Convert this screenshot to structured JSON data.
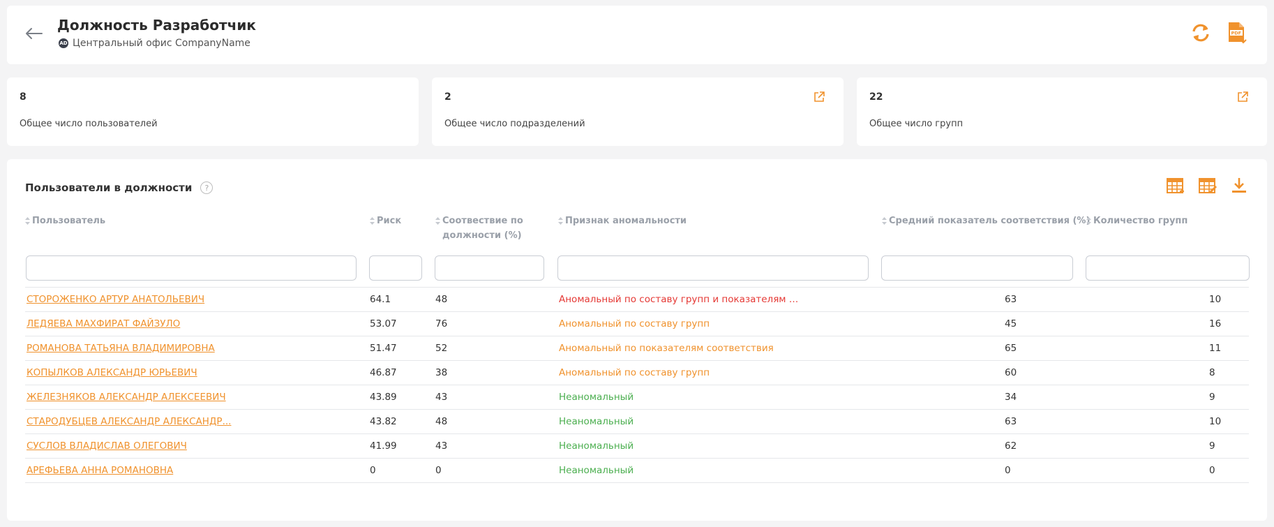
{
  "header": {
    "title": "Должность Разработчик",
    "subtitle": "Центральный офис CompanyName",
    "ad_badge": "AD"
  },
  "stats": [
    {
      "value": "8",
      "label": "Общее число пользователей"
    },
    {
      "value": "2",
      "label": "Общее число подразделений"
    },
    {
      "value": "22",
      "label": "Общее число групп"
    }
  ],
  "section": {
    "title": "Пользователи в должности",
    "help": "?"
  },
  "columns": [
    {
      "label": "Пользователь"
    },
    {
      "label": "Риск"
    },
    {
      "label": "Соотвествие по должности (%)"
    },
    {
      "label": "Признак аномальности"
    },
    {
      "label": "Средний показатель соответствия (%)"
    },
    {
      "label": "Количество групп"
    }
  ],
  "rows": [
    {
      "user": "СТОРОЖЕНКО АРТУР АНАТОЛЬЕВИЧ",
      "risk": "64.1",
      "match": "48",
      "anomaly": "Аномальный по составу групп и показателям соо...",
      "status": "red",
      "avg": "63",
      "groups": "10"
    },
    {
      "user": "ЛЕДЯЕВА МАХФИРАТ ФАЙЗУЛО",
      "risk": "53.07",
      "match": "76",
      "anomaly": "Аномальный по составу групп",
      "status": "orange",
      "avg": "45",
      "groups": "16"
    },
    {
      "user": "РОМАНОВА ТАТЬЯНА ВЛАДИМИРОВНА",
      "risk": "51.47",
      "match": "52",
      "anomaly": "Аномальный по показателям соответствия",
      "status": "orange",
      "avg": "65",
      "groups": "11"
    },
    {
      "user": "КОПЫЛКОВ АЛЕКСАНДР ЮРЬЕВИЧ",
      "risk": "46.87",
      "match": "38",
      "anomaly": "Аномальный по составу групп",
      "status": "orange",
      "avg": "60",
      "groups": "8"
    },
    {
      "user": "ЖЕЛЕЗНЯКОВ АЛЕКСАНДР АЛЕКСЕЕВИЧ",
      "risk": "43.89",
      "match": "43",
      "anomaly": "Неаномальный",
      "status": "green",
      "avg": "34",
      "groups": "9"
    },
    {
      "user": "СТАРОДУБЦЕВ АЛЕКСАНДР АЛЕКСАНДР...",
      "risk": "43.82",
      "match": "48",
      "anomaly": "Неаномальный",
      "status": "green",
      "avg": "63",
      "groups": "10"
    },
    {
      "user": "СУСЛОВ ВЛАДИСЛАВ ОЛЕГОВИЧ",
      "risk": "41.99",
      "match": "43",
      "anomaly": "Неаномальный",
      "status": "green",
      "avg": "62",
      "groups": "9"
    },
    {
      "user": "АРЕФЬЕВА АННА РОМАНОВНА",
      "risk": "0",
      "match": "0",
      "anomaly": "Неаномальный",
      "status": "green",
      "avg": "0",
      "groups": "0"
    }
  ],
  "colors": {
    "accent": "#f0922d",
    "red": "#e53935",
    "orange": "#f0922d",
    "green": "#4caf50"
  },
  "icons": {
    "back": "arrow-left-icon",
    "refresh": "refresh-icon",
    "pdf": "pdf-export-icon",
    "external": "external-link-icon",
    "columns_settings": "table-columns-icon",
    "table_edit": "table-edit-icon",
    "download": "download-icon",
    "help": "help-icon",
    "sort": "sort-icon"
  }
}
